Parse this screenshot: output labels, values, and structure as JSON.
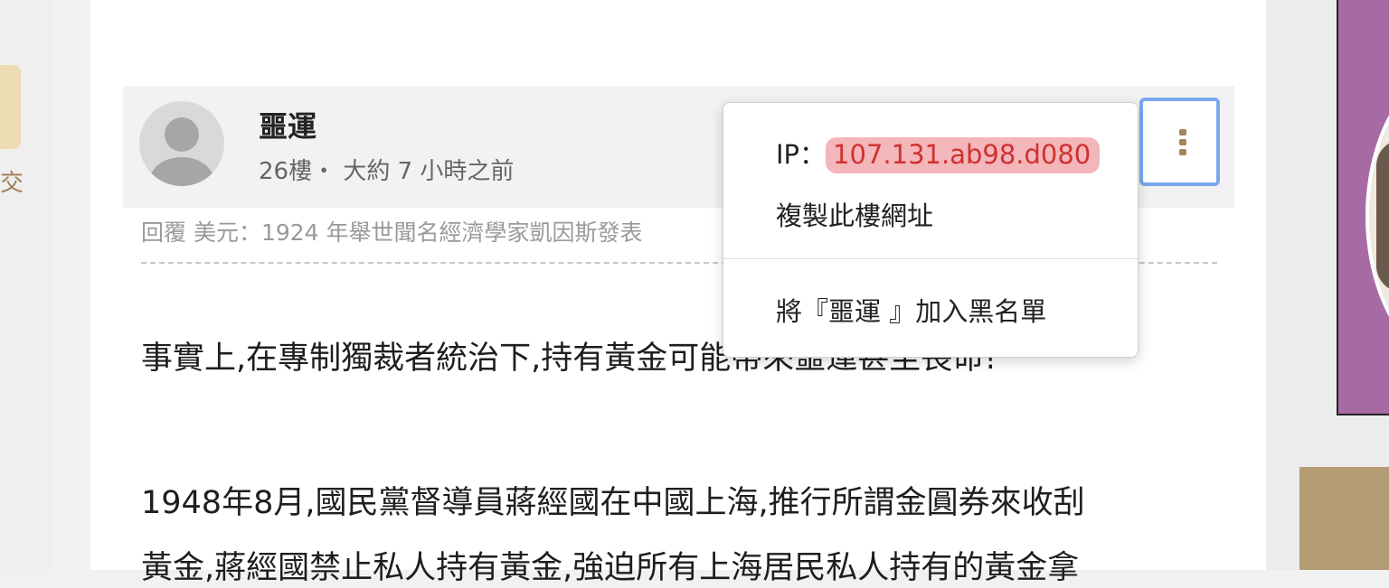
{
  "left_rail": {
    "char": "交"
  },
  "post": {
    "author": "噩運",
    "meta": "26樓・ 大約 7 小時之前",
    "quote": "回覆 美元：1924 年舉世聞名經濟學家凱因斯發表",
    "paragraphs": [
      "事實上,在專制獨裁者統治下,持有黃金可能帶來噩運甚至喪命!",
      "1948年8月,國民黨督導員蔣經國在中國上海,推行所謂金圓券來收刮",
      "黃金,蔣經國禁止私人持有黃金,強迫所有上海居民私人持有的黃金拿"
    ]
  },
  "popup": {
    "ip_label": "IP：",
    "ip_value": "107.131.ab98.d080",
    "copy_label": "複製此樓網址",
    "block_label": "將『噩運 』加入黑名單"
  },
  "colors": {
    "accent_brown": "#a3855a",
    "focus_blue": "#7aa8ee",
    "ip_highlight": "#f3b6ba",
    "ip_text": "#d0312f",
    "purple_panel": "#a76aa4",
    "tan_panel": "#b49d74"
  }
}
